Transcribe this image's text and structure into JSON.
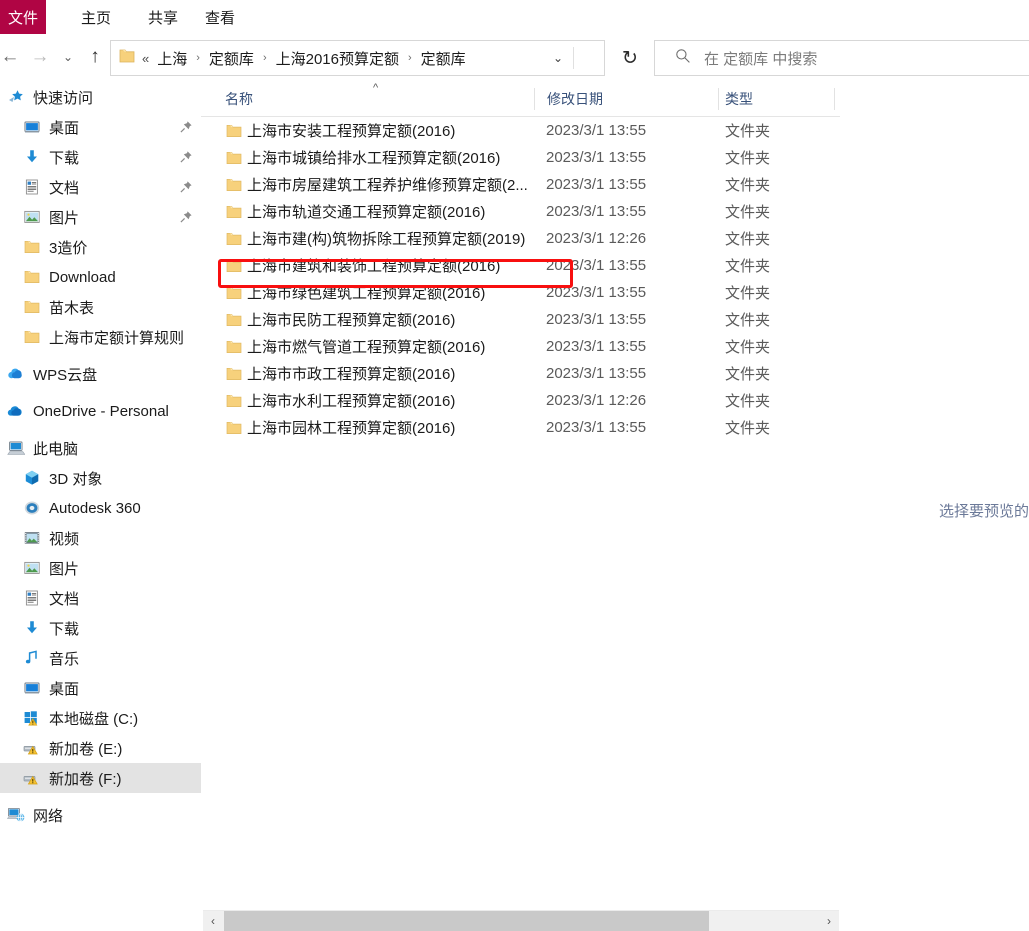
{
  "ribbon": {
    "file_tab": "文件",
    "file_tab_color": "#b00544",
    "tabs": [
      {
        "label": "主页"
      },
      {
        "label": "共享"
      },
      {
        "label": "查看"
      }
    ]
  },
  "nav": {
    "back_icon": "arrow-left-icon",
    "forward_icon": "arrow-right-icon",
    "recent_icon": "chevron-down-icon",
    "up_icon": "arrow-up-icon",
    "refresh_icon": "refresh-icon",
    "back_glyph": "←",
    "forward_glyph": "→",
    "recent_glyph": "⌄",
    "up_glyph": "↑",
    "refresh_glyph": "↻"
  },
  "breadcrumb": {
    "overflow": "«",
    "separator": "›",
    "dropdown_glyph": "⌄",
    "crumbs": [
      {
        "label": "上海"
      },
      {
        "label": "定额库"
      },
      {
        "label": "上海2016预算定额"
      },
      {
        "label": "定额库"
      }
    ]
  },
  "search": {
    "placeholder": "在 定额库 中搜索",
    "icon": "search-icon"
  },
  "sidebar": {
    "items": [
      {
        "label": "快速访问",
        "icon": "quick-access-star-icon",
        "level": 0,
        "pinned": false,
        "selected": false
      },
      {
        "label": "桌面",
        "icon": "desktop-icon",
        "level": 1,
        "pinned": true,
        "selected": false
      },
      {
        "label": "下载",
        "icon": "downloads-arrow-icon",
        "level": 1,
        "pinned": true,
        "selected": false
      },
      {
        "label": "文档",
        "icon": "documents-icon",
        "level": 1,
        "pinned": true,
        "selected": false
      },
      {
        "label": "图片",
        "icon": "pictures-icon",
        "level": 1,
        "pinned": true,
        "selected": false
      },
      {
        "label": "3造价",
        "icon": "folder-icon",
        "level": 1,
        "pinned": false,
        "selected": false
      },
      {
        "label": "Download",
        "icon": "folder-icon",
        "level": 1,
        "pinned": false,
        "selected": false
      },
      {
        "label": "苗木表",
        "icon": "folder-icon",
        "level": 1,
        "pinned": false,
        "selected": false
      },
      {
        "label": "上海市定额计算规则",
        "icon": "folder-icon",
        "level": 1,
        "pinned": false,
        "selected": false
      },
      {
        "label": "WPS云盘",
        "icon": "wps-cloud-icon",
        "level": 0,
        "pinned": false,
        "selected": false,
        "gap_before": true
      },
      {
        "label": "OneDrive - Personal",
        "icon": "onedrive-cloud-icon",
        "level": 0,
        "pinned": false,
        "selected": false,
        "gap_before": true
      },
      {
        "label": "此电脑",
        "icon": "this-pc-icon",
        "level": 0,
        "pinned": false,
        "selected": false,
        "gap_before": true
      },
      {
        "label": "3D 对象",
        "icon": "3d-objects-icon",
        "level": 1,
        "pinned": false,
        "selected": false
      },
      {
        "label": "Autodesk 360",
        "icon": "autodesk-360-icon",
        "level": 1,
        "pinned": false,
        "selected": false
      },
      {
        "label": "视频",
        "icon": "videos-icon",
        "level": 1,
        "pinned": false,
        "selected": false
      },
      {
        "label": "图片",
        "icon": "pictures-icon",
        "level": 1,
        "pinned": false,
        "selected": false
      },
      {
        "label": "文档",
        "icon": "documents-icon",
        "level": 1,
        "pinned": false,
        "selected": false
      },
      {
        "label": "下载",
        "icon": "downloads-arrow-icon",
        "level": 1,
        "pinned": false,
        "selected": false
      },
      {
        "label": "音乐",
        "icon": "music-note-icon",
        "level": 1,
        "pinned": false,
        "selected": false
      },
      {
        "label": "桌面",
        "icon": "desktop-icon",
        "level": 1,
        "pinned": false,
        "selected": false
      },
      {
        "label": "本地磁盘 (C:)",
        "icon": "windows-drive-icon",
        "level": 1,
        "pinned": false,
        "selected": false
      },
      {
        "label": "新加卷 (E:)",
        "icon": "drive-warning-icon",
        "level": 1,
        "pinned": false,
        "selected": false
      },
      {
        "label": "新加卷 (F:)",
        "icon": "drive-warning-icon",
        "level": 1,
        "pinned": false,
        "selected": true
      },
      {
        "label": "网络",
        "icon": "network-icon",
        "level": 0,
        "pinned": false,
        "selected": false,
        "gap_before": true
      }
    ]
  },
  "file_list": {
    "columns": [
      {
        "label": "名称",
        "sorted": true,
        "sort_direction": "asc"
      },
      {
        "label": "修改日期",
        "sorted": false,
        "sort_direction": ""
      },
      {
        "label": "类型",
        "sorted": false,
        "sort_direction": ""
      }
    ],
    "sort_glyph": "^",
    "rows": [
      {
        "name": "上海市安装工程预算定额(2016)",
        "date": "2023/3/1 13:55",
        "type": "文件夹",
        "icon": "folder-icon",
        "highlighted": false
      },
      {
        "name": "上海市城镇给排水工程预算定额(2016)",
        "date": "2023/3/1 13:55",
        "type": "文件夹",
        "icon": "folder-icon",
        "highlighted": false
      },
      {
        "name": "上海市房屋建筑工程养护维修预算定额(2...",
        "date": "2023/3/1 13:55",
        "type": "文件夹",
        "icon": "folder-icon",
        "highlighted": false
      },
      {
        "name": "上海市轨道交通工程预算定额(2016)",
        "date": "2023/3/1 13:55",
        "type": "文件夹",
        "icon": "folder-icon",
        "highlighted": false
      },
      {
        "name": "上海市建(构)筑物拆除工程预算定额(2019)",
        "date": "2023/3/1 12:26",
        "type": "文件夹",
        "icon": "folder-icon",
        "highlighted": false
      },
      {
        "name": "上海市建筑和装饰工程预算定额(2016)",
        "date": "2023/3/1 13:55",
        "type": "文件夹",
        "icon": "folder-icon",
        "highlighted": true
      },
      {
        "name": "上海市绿色建筑工程预算定额(2016)",
        "date": "2023/3/1 13:55",
        "type": "文件夹",
        "icon": "folder-icon",
        "highlighted": false
      },
      {
        "name": "上海市民防工程预算定额(2016)",
        "date": "2023/3/1 13:55",
        "type": "文件夹",
        "icon": "folder-icon",
        "highlighted": false
      },
      {
        "name": "上海市燃气管道工程预算定额(2016)",
        "date": "2023/3/1 13:55",
        "type": "文件夹",
        "icon": "folder-icon",
        "highlighted": false
      },
      {
        "name": "上海市市政工程预算定额(2016)",
        "date": "2023/3/1 13:55",
        "type": "文件夹",
        "icon": "folder-icon",
        "highlighted": false
      },
      {
        "name": "上海市水利工程预算定额(2016)",
        "date": "2023/3/1 12:26",
        "type": "文件夹",
        "icon": "folder-icon",
        "highlighted": false
      },
      {
        "name": "上海市园林工程预算定额(2016)",
        "date": "2023/3/1 13:55",
        "type": "文件夹",
        "icon": "folder-icon",
        "highlighted": false
      }
    ]
  },
  "annotation": {
    "color": "#f80f0f",
    "target_row": "上海市建筑和装饰工程预算定额(2016)"
  },
  "preview": {
    "text": "选择要预览的"
  },
  "scrollbar": {
    "left_glyph": "‹",
    "right_glyph": "›"
  }
}
